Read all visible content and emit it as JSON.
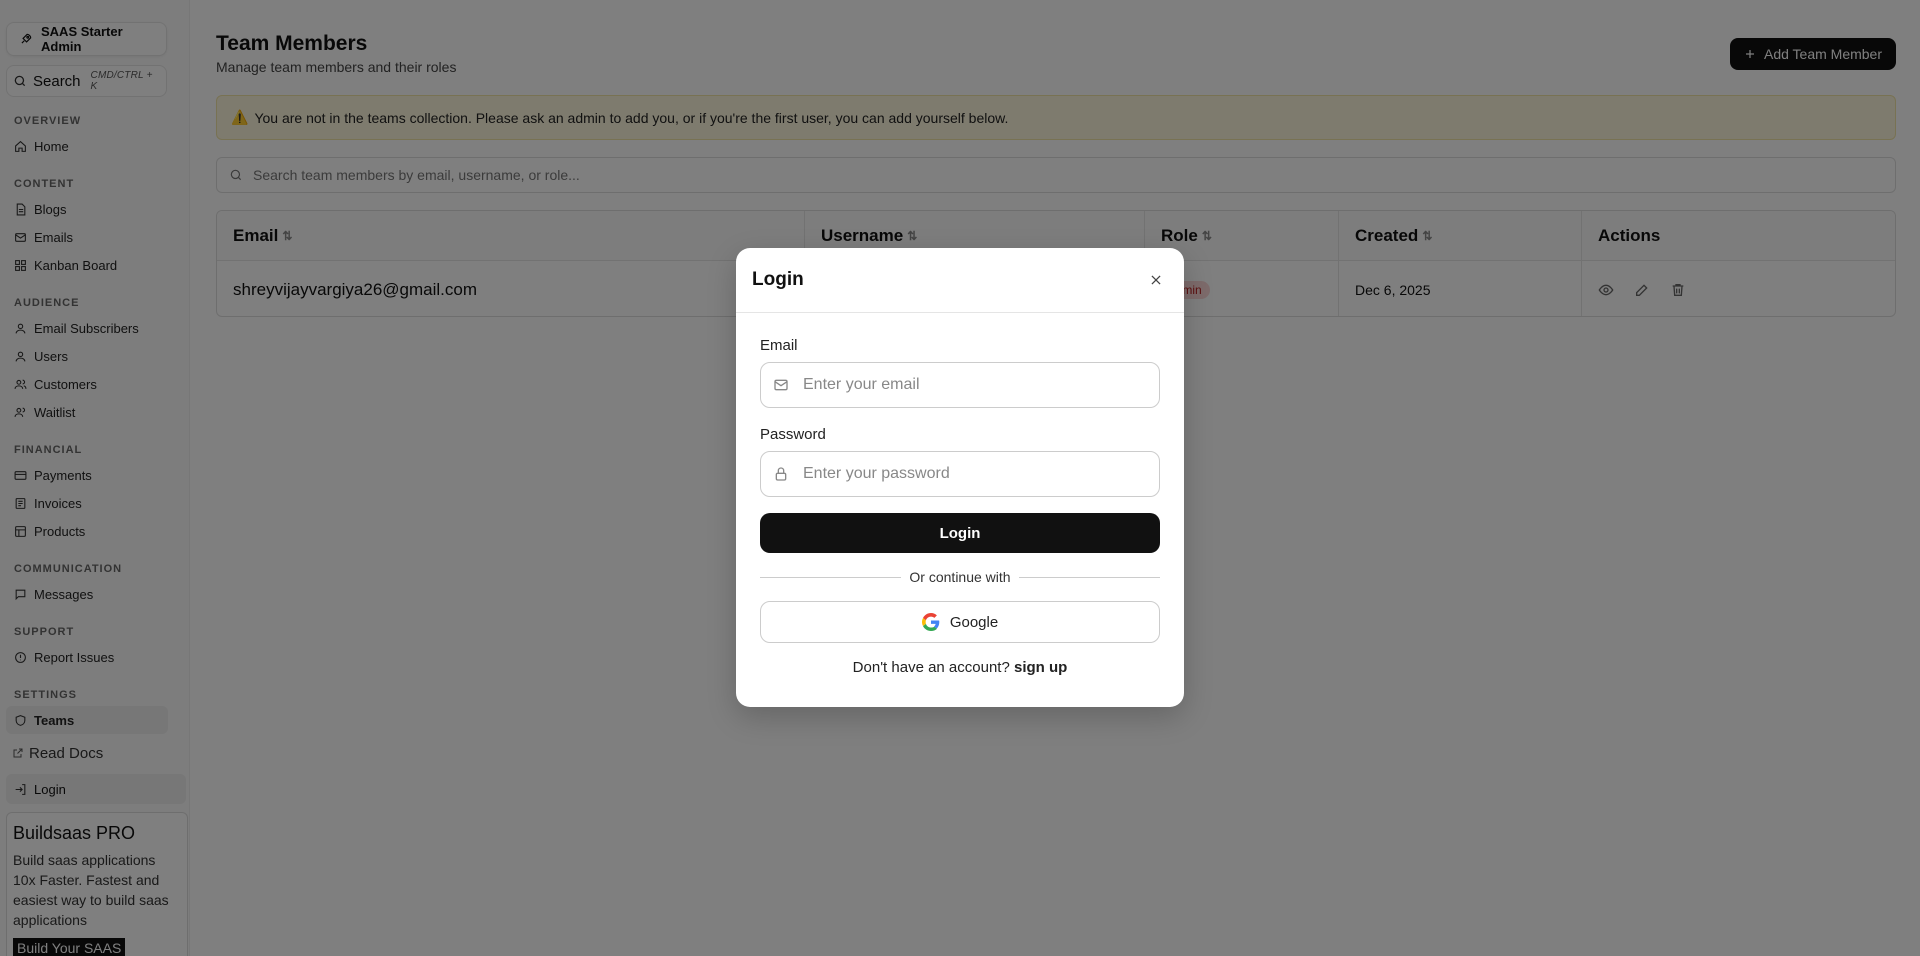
{
  "sidebar": {
    "brand": "SAAS Starter Admin",
    "search": {
      "label": "Search",
      "shortcut": "CMD/CTRL + K"
    },
    "groups": [
      {
        "title": "OVERVIEW",
        "items": [
          {
            "label": "Home",
            "icon": "home-icon"
          }
        ]
      },
      {
        "title": "CONTENT",
        "items": [
          {
            "label": "Blogs",
            "icon": "document-icon"
          },
          {
            "label": "Emails",
            "icon": "mail-icon"
          },
          {
            "label": "Kanban Board",
            "icon": "grid-icon"
          }
        ]
      },
      {
        "title": "AUDIENCE",
        "items": [
          {
            "label": "Email Subscribers",
            "icon": "user-icon"
          },
          {
            "label": "Users",
            "icon": "user-icon"
          },
          {
            "label": "Customers",
            "icon": "users-icon"
          },
          {
            "label": "Waitlist",
            "icon": "users-icon"
          }
        ]
      },
      {
        "title": "FINANCIAL",
        "items": [
          {
            "label": "Payments",
            "icon": "card-icon"
          },
          {
            "label": "Invoices",
            "icon": "receipt-icon"
          },
          {
            "label": "Products",
            "icon": "box-icon"
          }
        ]
      },
      {
        "title": "COMMUNICATION",
        "items": [
          {
            "label": "Messages",
            "icon": "message-icon"
          }
        ]
      },
      {
        "title": "SUPPORT",
        "items": [
          {
            "label": "Report Issues",
            "icon": "alert-circle-icon"
          }
        ]
      },
      {
        "title": "SETTINGS",
        "items": [
          {
            "label": "Teams",
            "icon": "shield-icon"
          }
        ]
      }
    ],
    "read_docs": "Read Docs",
    "login": "Login",
    "promo": {
      "title": "Buildsaas PRO",
      "text": "Build saas applications 10x Faster. Fastest and easiest way to build saas applications",
      "cta": "Build Your SAAS"
    }
  },
  "main": {
    "title": "Team Members",
    "subtitle": "Manage team members and their roles",
    "add_button": "Add Team Member",
    "warning": "You are not in the teams collection. Please ask an admin to add you, or if you're the first user, you can add yourself below.",
    "search_placeholder": "Search team members by email, username, or role...",
    "table": {
      "headers": [
        "Email",
        "Username",
        "Role",
        "Created",
        "Actions"
      ],
      "rows": [
        {
          "email": "shreyvijayvargiya26@gmail.com",
          "username": "",
          "role": "admin",
          "created": "Dec 6, 2025"
        }
      ]
    }
  },
  "modal": {
    "title": "Login",
    "email_label": "Email",
    "email_placeholder": "Enter your email",
    "password_label": "Password",
    "password_placeholder": "Enter your password",
    "login_button": "Login",
    "divider": "Or continue with",
    "google_button": "Google",
    "signup_prompt": "Don't have an account?",
    "signup_link": "sign up"
  }
}
